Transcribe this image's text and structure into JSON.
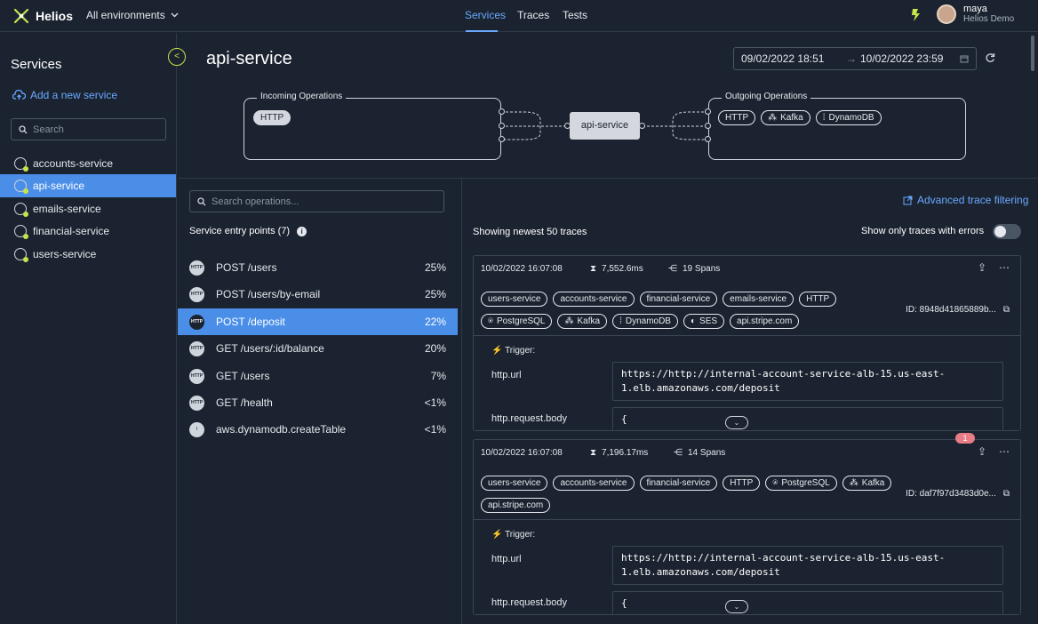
{
  "app": {
    "brand": "Helios",
    "environment": "All environments",
    "accent": "#4a8ee8",
    "brand_color": "#c6e54a"
  },
  "nav": {
    "services": "Services",
    "traces": "Traces",
    "tests": "Tests"
  },
  "user": {
    "name": "maya",
    "org": "Helios Demo"
  },
  "sidebar": {
    "title": "Services",
    "add_label": "Add a new service",
    "search_placeholder": "Search",
    "items": [
      {
        "label": "accounts-service"
      },
      {
        "label": "api-service",
        "selected": true
      },
      {
        "label": "emails-service"
      },
      {
        "label": "financial-service"
      },
      {
        "label": "users-service"
      }
    ]
  },
  "page": {
    "title": "api-service",
    "date_from": "09/02/2022 18:51",
    "date_arrow": "→",
    "date_to": "10/02/2022 23:59"
  },
  "topology": {
    "incoming_title": "Incoming Operations",
    "incoming": [
      "HTTP"
    ],
    "center": "api-service",
    "outgoing_title": "Outgoing Operations",
    "outgoing": [
      "HTTP",
      "Kafka",
      "DynamoDB"
    ]
  },
  "operations": {
    "search_placeholder": "Search operations...",
    "title": "Service entry points (7)",
    "items": [
      {
        "icon": "HTTP",
        "label": "POST /users",
        "pct": "25%"
      },
      {
        "icon": "HTTP",
        "label": "POST /users/by-email",
        "pct": "25%"
      },
      {
        "icon": "HTTP",
        "label": "POST /deposit",
        "pct": "22%",
        "selected": true
      },
      {
        "icon": "HTTP",
        "label": "GET /users/:id/balance",
        "pct": "20%"
      },
      {
        "icon": "HTTP",
        "label": "GET /users",
        "pct": "7%"
      },
      {
        "icon": "HTTP",
        "label": "GET /health",
        "pct": "<1%"
      },
      {
        "icon": "DB",
        "label": "aws.dynamodb.createTable",
        "pct": "<1%"
      }
    ]
  },
  "traces": {
    "advanced_filter": "Advanced trace filtering",
    "showing": "Showing newest 50 traces",
    "errors_toggle": "Show only traces with errors",
    "errors_only": false,
    "items": [
      {
        "timestamp": "10/02/2022 16:07:08",
        "duration": "7,552.6ms",
        "spans": "19 Spans",
        "tags": [
          "users-service",
          "accounts-service",
          "financial-service",
          "emails-service",
          "HTTP",
          "PostgreSQL",
          "Kafka",
          "DynamoDB",
          "SES",
          "api.stripe.com"
        ],
        "id": "ID: 8948d41865889b...",
        "trigger": "Trigger:",
        "url_key": "http.url",
        "url_value": "https://http://internal-account-service-alb-15.us-east-1.elb.amazonaws.com/deposit",
        "body_key": "http.request.body",
        "body_value": "{"
      },
      {
        "timestamp": "10/02/2022 16:07:08",
        "duration": "7,196.17ms",
        "spans": "14 Spans",
        "error_count": "1",
        "tags": [
          "users-service",
          "accounts-service",
          "financial-service",
          "HTTP",
          "PostgreSQL",
          "Kafka",
          "api.stripe.com"
        ],
        "id": "ID: daf7f97d3483d0e...",
        "trigger": "Trigger:",
        "url_key": "http.url",
        "url_value": "https://http://internal-account-service-alb-15.us-east-1.elb.amazonaws.com/deposit",
        "body_key": "http.request.body",
        "body_value": "{"
      }
    ]
  }
}
